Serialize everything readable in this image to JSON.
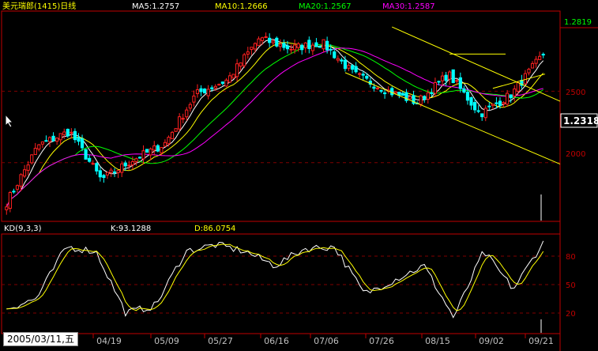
{
  "header": {
    "title": "美元瑞郎(1415)日线",
    "ma5": "MA5:1.2757",
    "ma10": "MA10:1.2666",
    "ma20": "MA20:1.2567",
    "ma30": "MA30:1.2587"
  },
  "price_axis": {
    "top_label": "1.2819",
    "current_label": "1.2318",
    "gridline_labels": [
      "2500",
      "2000"
    ]
  },
  "kd_panel": {
    "title": "KD(9,3,3)",
    "k_label": "K:93.1288",
    "d_label": "D:86.0754",
    "levels": [
      "80",
      "50",
      "20"
    ]
  },
  "x_axis": {
    "first_date": "2005/03/11,五",
    "ticks": [
      "04/19",
      "05/09",
      "05/27",
      "06/16",
      "07/06",
      "07/26",
      "08/15",
      "09/02",
      "09/21"
    ]
  },
  "colors": {
    "up": "#ff2020",
    "down": "#00ffff",
    "ma5": "#ffffff",
    "ma10": "#ffff00",
    "ma20": "#00ff00",
    "ma30": "#ff00ff",
    "grid": "#800000",
    "trendline": "#ffff00"
  },
  "chart_data": [
    {
      "type": "candlestick",
      "title": "美元瑞郎(1415)日线",
      "ylim": [
        1.16,
        1.305
      ],
      "x": [
        "04/19",
        "05/09",
        "05/27",
        "06/16",
        "07/06",
        "07/26",
        "08/15",
        "09/02",
        "09/21"
      ],
      "close_anchors": [
        1.172,
        1.212,
        1.222,
        1.188,
        1.202,
        1.213,
        1.248,
        1.258,
        1.287,
        1.28,
        1.284,
        1.262,
        1.251,
        1.242,
        1.262,
        1.234,
        1.248,
        1.276
      ],
      "series": [
        {
          "name": "MA5",
          "last": 1.2757
        },
        {
          "name": "MA10",
          "last": 1.2666
        },
        {
          "name": "MA20",
          "last": 1.2567
        },
        {
          "name": "MA30",
          "last": 1.2587
        }
      ],
      "last_price": 1.2318,
      "high_marker": 1.2819,
      "gridlines": [
        1.25,
        1.2
      ]
    },
    {
      "type": "line",
      "title": "KD(9,3,3)",
      "ylim": [
        0,
        100
      ],
      "series": [
        {
          "name": "K",
          "last": 93.1288
        },
        {
          "name": "D",
          "last": 86.0754
        }
      ],
      "k_anchors": [
        25,
        35,
        90,
        85,
        20,
        28,
        85,
        92,
        85,
        70,
        88,
        90,
        40,
        55,
        70,
        15,
        85,
        45,
        95
      ],
      "levels": [
        80,
        50,
        20
      ]
    }
  ]
}
